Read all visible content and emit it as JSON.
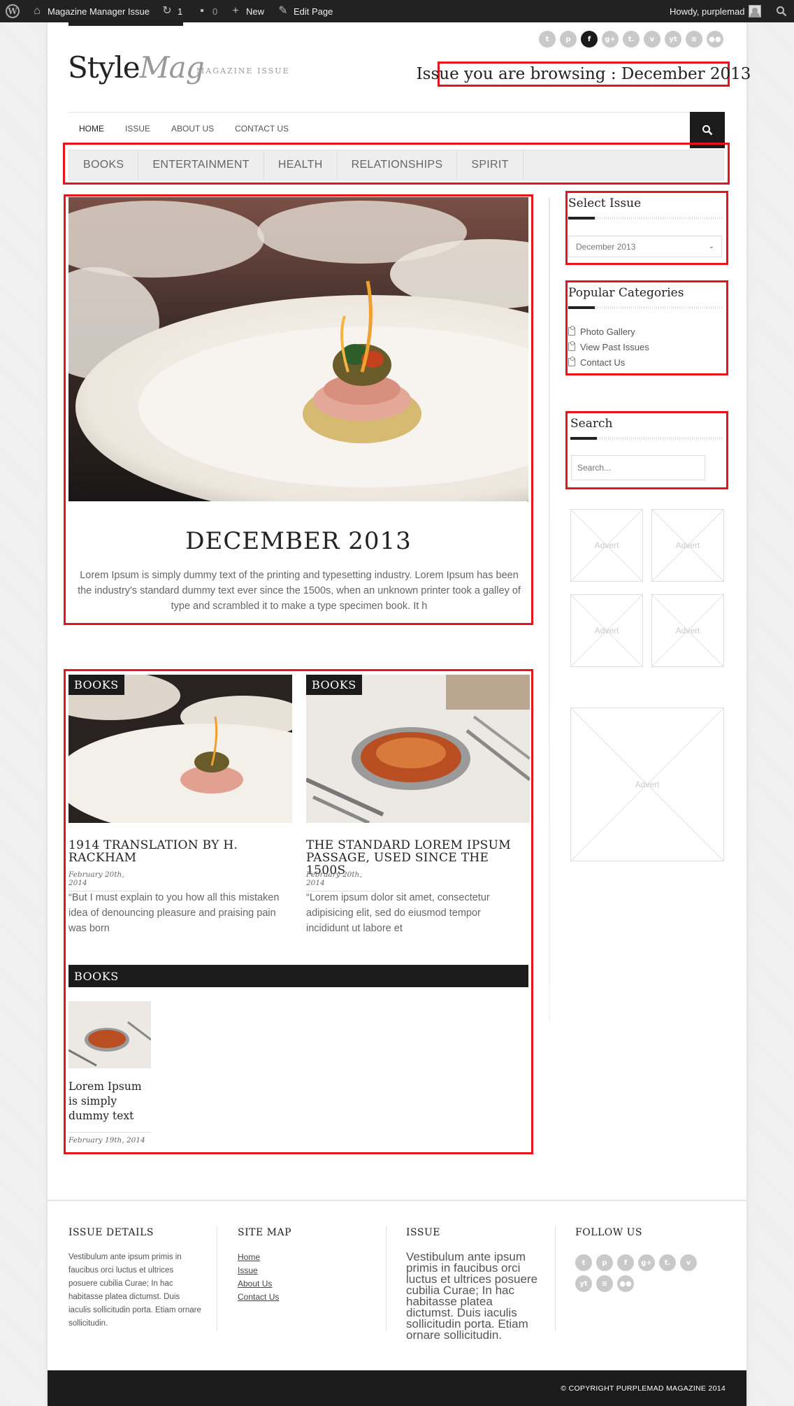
{
  "admin_bar": {
    "site_name": "Magazine Manager Issue",
    "updates_count": "1",
    "comments_count": "0",
    "new_label": "New",
    "edit_label": "Edit Page",
    "howdy": "Howdy, purplemad"
  },
  "header": {
    "logo_main": "Style",
    "logo_accent": "Mag",
    "tagline": "MAGAZINE ISSUE",
    "browsing": "Issue you are browsing : December 2013",
    "social_icons": [
      "twitter-icon",
      "pinterest-icon",
      "facebook-icon",
      "google-plus-icon",
      "tumblr-icon",
      "vimeo-icon",
      "youtube-icon",
      "rss-icon",
      "flickr-icon"
    ],
    "social_glyphs": [
      "t",
      "p",
      "f",
      "g+",
      "t.",
      "v",
      "yt",
      "≋",
      "●●"
    ]
  },
  "nav": {
    "items": [
      "HOME",
      "ISSUE",
      "ABOUT US",
      "CONTACT US"
    ]
  },
  "categories": [
    "BOOKS",
    "ENTERTAINMENT",
    "HEALTH",
    "RELATIONSHIPS",
    "SPIRIT"
  ],
  "featured": {
    "title": "DECEMBER 2013",
    "text": "Lorem Ipsum is simply dummy text of the printing and typesetting industry. Lorem Ipsum has been the industry's standard dummy text ever since the 1500s, when an unknown printer took a galley of type and scrambled it to make a type specimen book. It h"
  },
  "posts": [
    {
      "tag": "BOOKS",
      "title": "1914 TRANSLATION BY H. RACKHAM",
      "date": "February 20th, 2014",
      "excerpt": "“But I must explain to you how all this mistaken idea of denouncing pleasure and praising pain was born"
    },
    {
      "tag": "BOOKS",
      "title": "THE STANDARD LOREM IPSUM PASSAGE, USED SINCE THE 1500S",
      "date": "February 20th, 2014",
      "excerpt": "“Lorem ipsum dolor sit amet, consectetur adipisicing elit, sed do eiusmod tempor incididunt ut labore et"
    }
  ],
  "books_section": {
    "title": "BOOKS",
    "item": {
      "title": "Lorem Ipsum is simply dummy text",
      "date": "February 19th, 2014"
    }
  },
  "sidebar": {
    "select_issue": {
      "title": "Select Issue",
      "value": "December 2013"
    },
    "popular": {
      "title": "Popular Categories",
      "items": [
        "Photo Gallery",
        "View Past Issues",
        "Contact Us"
      ]
    },
    "search": {
      "title": "Search",
      "placeholder": "Search..."
    },
    "advert_label": "Advert"
  },
  "footer": {
    "col1": {
      "title": "ISSUE DETAILS",
      "text": "Vestibulum ante ipsum primis in faucibus orci luctus et ultrices posuere cubilia Curae; In hac habitasse platea dictumst. Duis iaculis sollicitudin porta. Etiam ornare sollicitudin."
    },
    "col2": {
      "title": "SITE MAP",
      "links": [
        "Home",
        "Issue",
        "About Us",
        "Contact Us"
      ]
    },
    "col3": {
      "title": "ISSUE",
      "text": "Vestibulum ante ipsum primis in faucibus orci luctus et ultrices posuere cubilia Curae; In hac habitasse platea dictumst. Duis iaculis sollicitudin porta. Etiam ornare sollicitudin."
    },
    "col4": {
      "title": "FOLLOW US",
      "icons": [
        "twitter-icon",
        "pinterest-icon",
        "facebook-icon",
        "google-plus-icon",
        "tumblr-icon",
        "vimeo-icon",
        "youtube-icon",
        "rss-icon",
        "flickr-icon"
      ],
      "glyphs": [
        "t",
        "p",
        "f",
        "g+",
        "t.",
        "v",
        "yt",
        "≋",
        "●●"
      ]
    },
    "copyright": "© COPYRIGHT PURPLEMAD MAGAZINE 2014"
  },
  "colors": {
    "accent_red": "#e8141b",
    "dark": "#1b1b1b",
    "admin_bar": "#222222"
  }
}
